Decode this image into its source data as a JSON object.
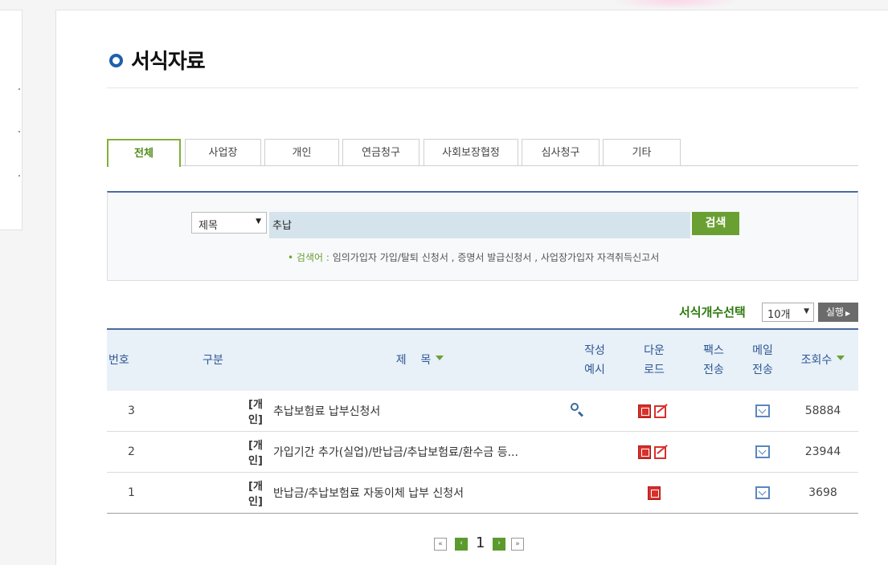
{
  "page": {
    "title": "서식자료"
  },
  "tabs": [
    {
      "label": "전체",
      "active": true
    },
    {
      "label": "사업장"
    },
    {
      "label": "개인"
    },
    {
      "label": "연금청구"
    },
    {
      "label": "사회보장협정"
    },
    {
      "label": "심사청구"
    },
    {
      "label": "기타"
    }
  ],
  "search": {
    "field_selected": "제목",
    "query": "추납",
    "button": "검색",
    "hint_label": "검색어 :",
    "hint_text": "임의가입자 가입/탈퇴 신청서 , 증명서 발급신청서 , 사업장가입자 자격취득신고서"
  },
  "list_controls": {
    "count_label": "서식개수선택",
    "count_selected": "10개",
    "run_button": "실행"
  },
  "table": {
    "headers": {
      "no": "번호",
      "category": "구분",
      "title": "제    목",
      "example_1": "작성",
      "example_2": "예시",
      "download_1": "다운",
      "download_2": "로드",
      "fax_1": "팩스",
      "fax_2": "전송",
      "mail_1": "메일",
      "mail_2": "전송",
      "views": "조회수"
    },
    "rows": [
      {
        "no": "3",
        "category": "[개인]",
        "title": "추납보험료 납부신청서",
        "example": true,
        "hwp": true,
        "pdf": true,
        "mail": true,
        "views": "58884"
      },
      {
        "no": "2",
        "category": "[개인]",
        "title": "가입기간 추가(실업)/반납금/추납보험료/환수금 등...",
        "example": false,
        "hwp": true,
        "pdf": true,
        "mail": true,
        "views": "23944"
      },
      {
        "no": "1",
        "category": "[개인]",
        "title": "반납금/추납보험료 자동이체 납부 신청서",
        "example": false,
        "hwp": true,
        "pdf": false,
        "mail": true,
        "views": "3698"
      }
    ]
  },
  "pagination": {
    "first": "«",
    "prev": "‹",
    "current": "1",
    "next": "›",
    "last": "»"
  },
  "colors": {
    "accent_green": "#6aa032",
    "header_blue": "#4b6a9d",
    "active_tab": "#7fb03a"
  }
}
